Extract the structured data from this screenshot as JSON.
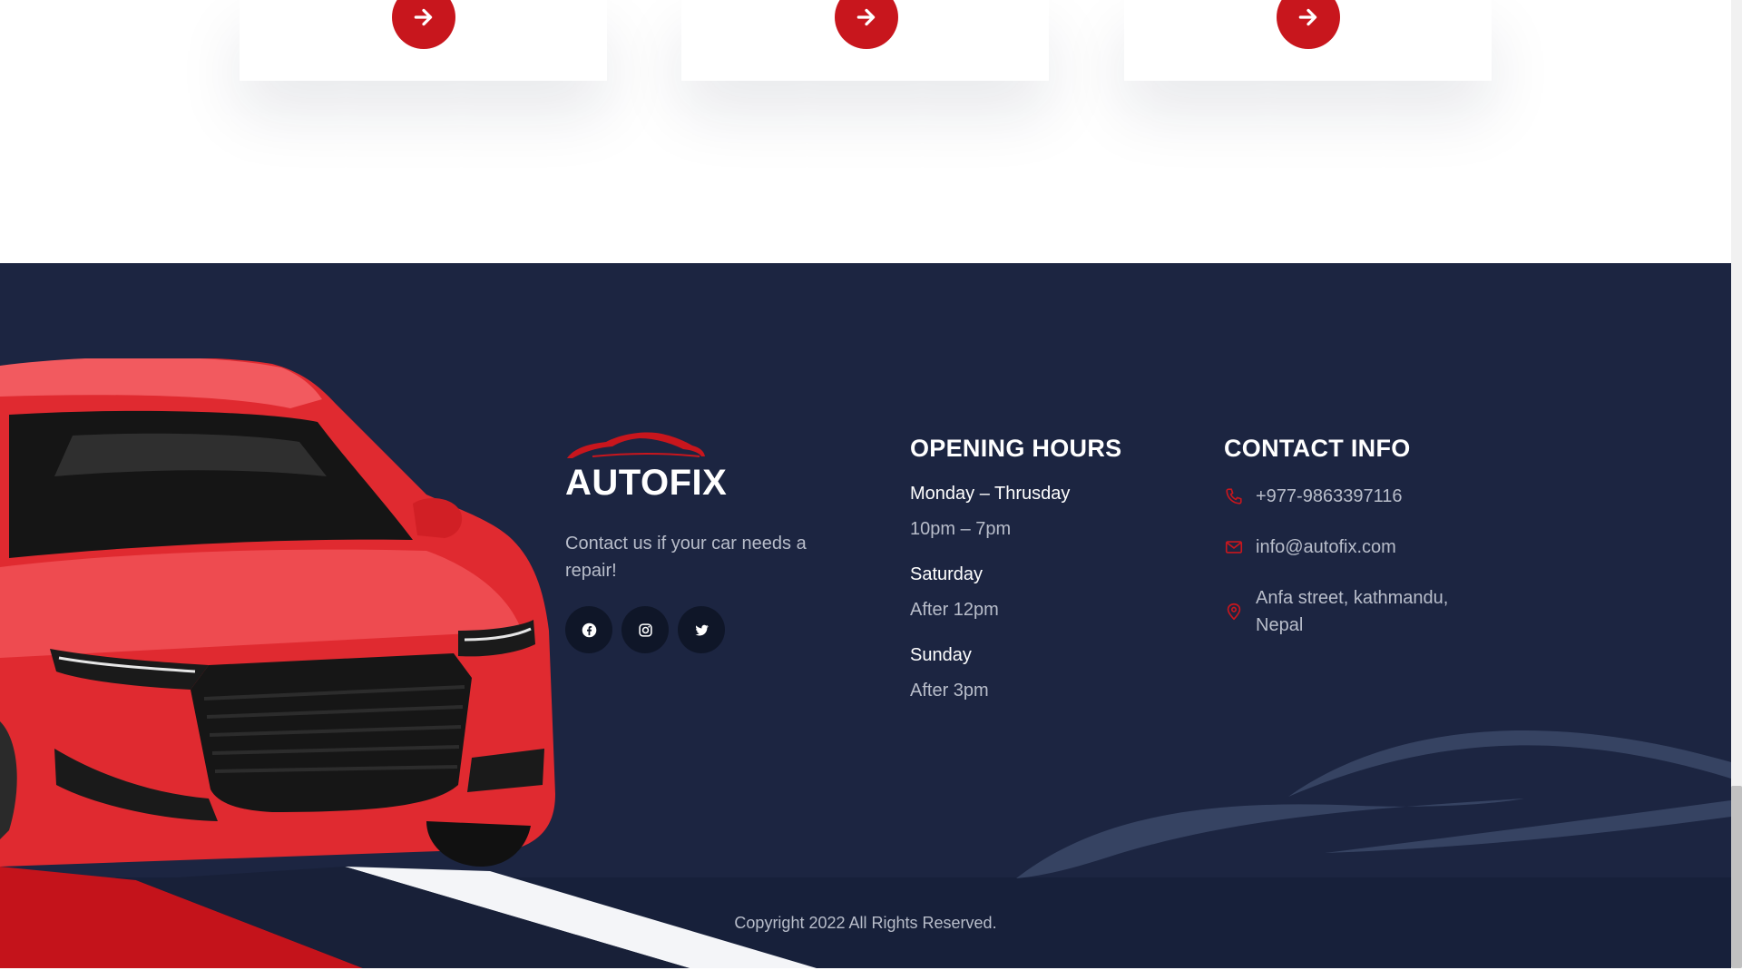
{
  "colors": {
    "accent": "#c8161d",
    "footer_bg": "#1c2541",
    "footer_bottom_bg": "#17203a",
    "muted_text": "#b8bdca",
    "heading_text": "#ffffff"
  },
  "cards": [
    {
      "icon": "arrow-right-icon"
    },
    {
      "icon": "arrow-right-icon"
    },
    {
      "icon": "arrow-right-icon"
    }
  ],
  "brand": {
    "logo_icon": "car-silhouette-icon",
    "name": "AUTOFIX",
    "tagline": "Contact us if your car needs a repair!"
  },
  "social": [
    {
      "icon": "facebook-icon"
    },
    {
      "icon": "instagram-icon"
    },
    {
      "icon": "twitter-icon"
    }
  ],
  "opening_hours": {
    "title": "OPENING HOURS",
    "entries": [
      {
        "day": "Monday – Thrusday",
        "time": "10pm – 7pm"
      },
      {
        "day": "Saturday",
        "time": "After 12pm"
      },
      {
        "day": "Sunday",
        "time": "After 3pm"
      }
    ]
  },
  "contact_info": {
    "title": "CONTACT INFO",
    "phone": {
      "icon": "phone-icon",
      "text": "+977-9863397116"
    },
    "email": {
      "icon": "mail-icon",
      "text": "info@autofix.com"
    },
    "address": {
      "icon": "map-pin-icon",
      "text": "Anfa street, kathmandu, Nepal"
    }
  },
  "footer": {
    "copyright": "Copyright 2022 All Rights Reserved."
  }
}
